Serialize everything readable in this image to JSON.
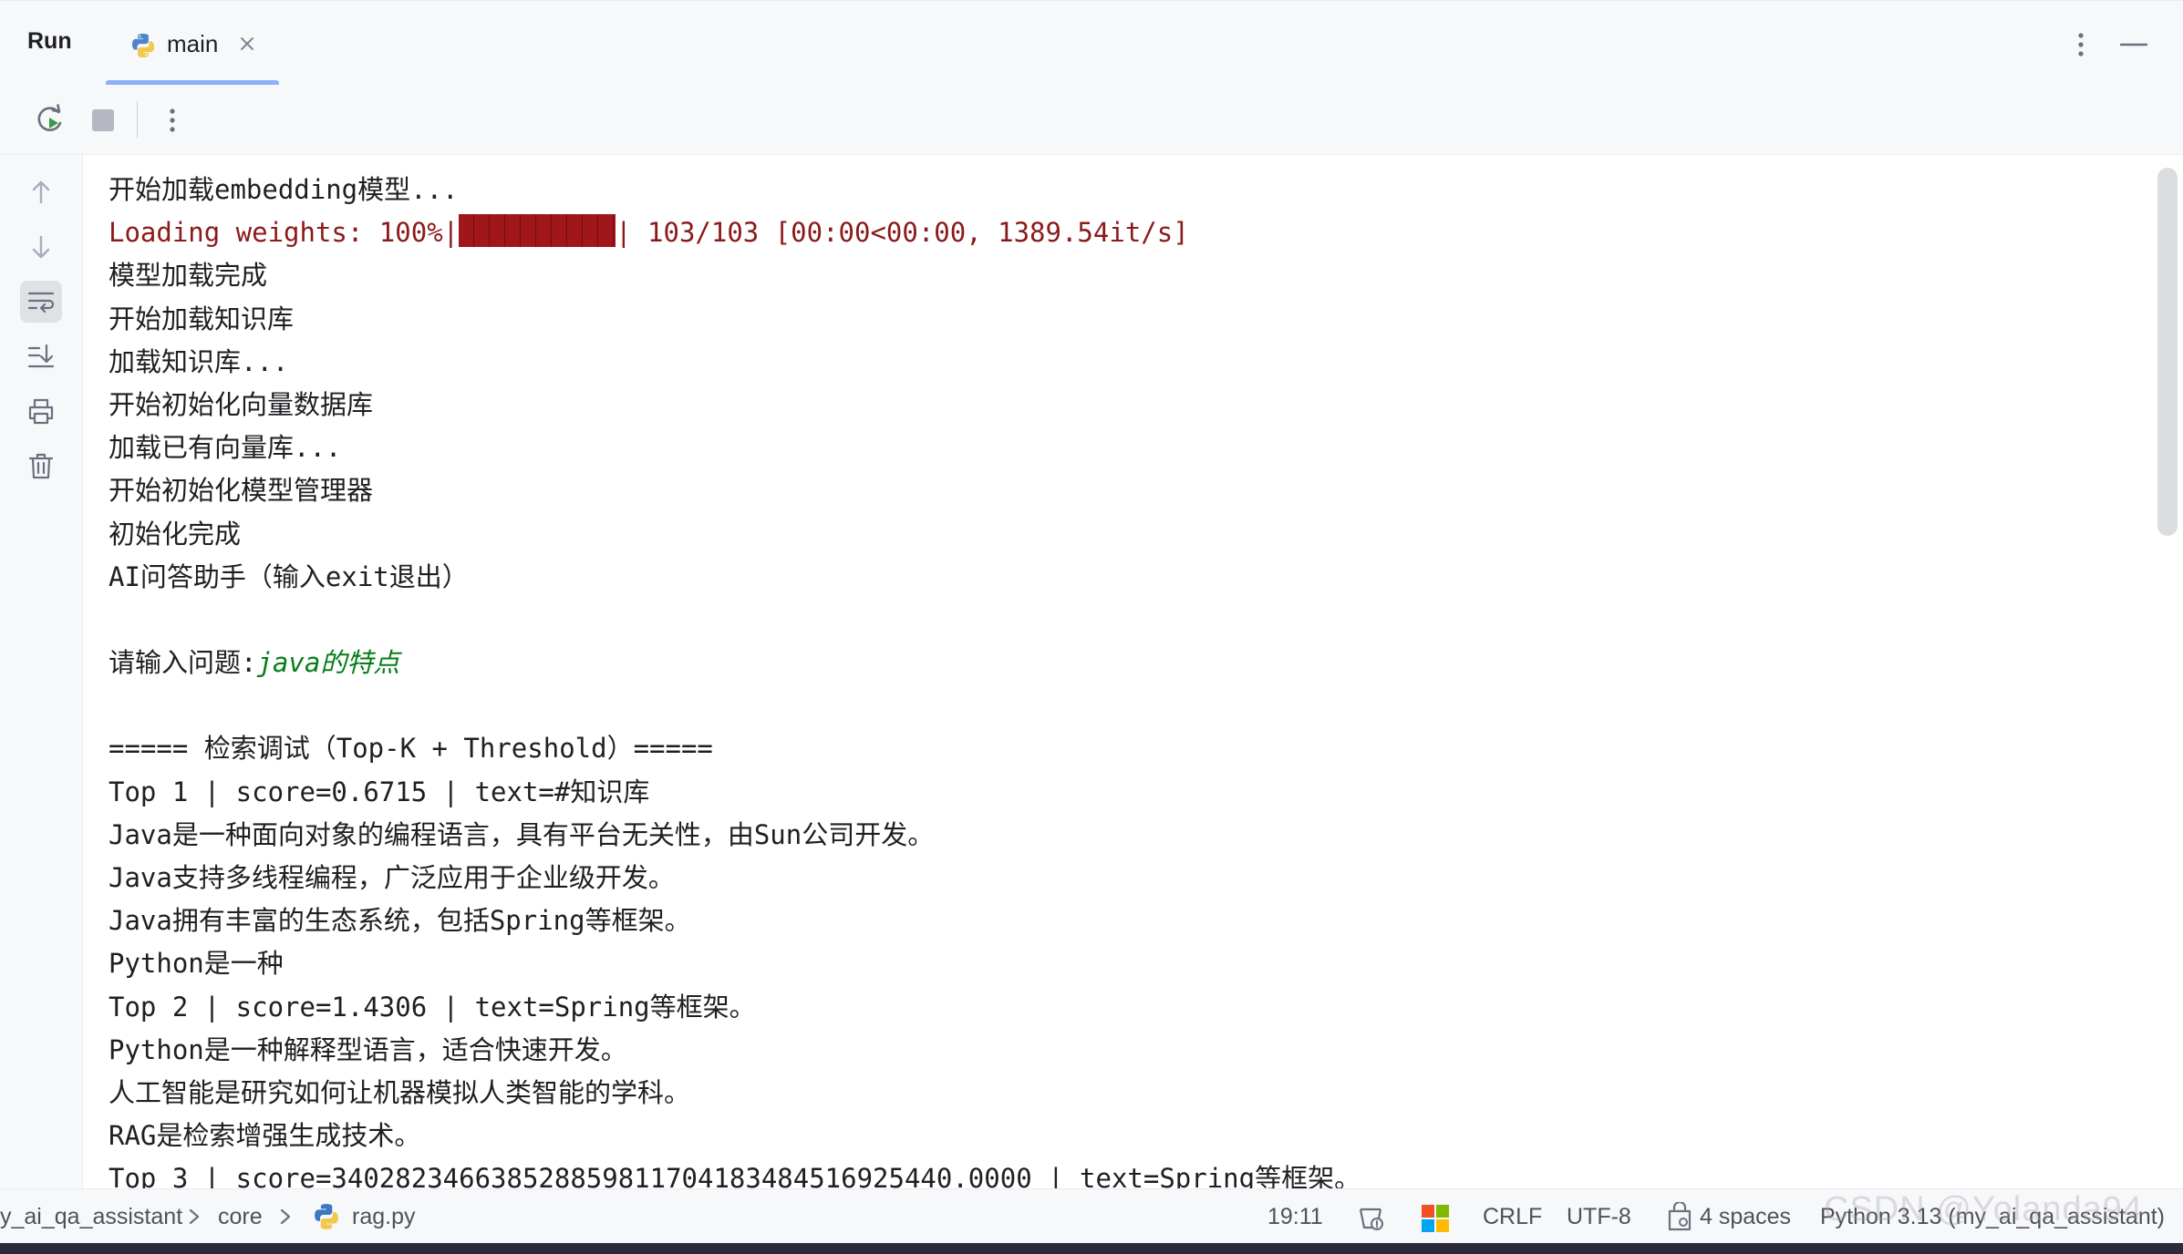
{
  "header": {
    "title": "Run",
    "tab": {
      "label": "main"
    }
  },
  "console": {
    "lines": [
      {
        "text": "开始加载embedding模型..."
      },
      {
        "prefix": "Loading weights: 100%|",
        "suffix": "| 103/103 [00:00<00:00, 1389.54it/s]",
        "progress_percent": 100
      },
      {
        "text": "模型加载完成"
      },
      {
        "text": "开始加载知识库"
      },
      {
        "text": "加载知识库..."
      },
      {
        "text": "开始初始化向量数据库"
      },
      {
        "text": "加载已有向量库..."
      },
      {
        "text": "开始初始化模型管理器"
      },
      {
        "text": "初始化完成"
      },
      {
        "text": "AI问答助手（输入exit退出）"
      },
      {
        "text": ""
      },
      {
        "prompt": "请输入问题:",
        "input": "java的特点"
      },
      {
        "text": ""
      },
      {
        "text": "===== 检索调试（Top-K + Threshold）====="
      },
      {
        "text": "Top 1 | score=0.6715 | text=#知识库"
      },
      {
        "text": "Java是一种面向对象的编程语言，具有平台无关性，由Sun公司开发。"
      },
      {
        "text": "Java支持多线程编程，广泛应用于企业级开发。"
      },
      {
        "text": "Java拥有丰富的生态系统，包括Spring等框架。"
      },
      {
        "text": "Python是一种"
      },
      {
        "text": "Top 2 | score=1.4306 | text=Spring等框架。"
      },
      {
        "text": "Python是一种解释型语言，适合快速开发。"
      },
      {
        "text": "人工智能是研究如何让机器模拟人类智能的学科。"
      },
      {
        "text": "RAG是检索增强生成技术。"
      },
      {
        "text": "Top 3 | score=340282346638528859811704183484516925440.0000 | text=Spring等框架。"
      }
    ]
  },
  "statusbar": {
    "breadcrumb": [
      "y_ai_qa_assistant",
      "core",
      "rag.py"
    ],
    "position": "19:11",
    "line_ending": "CRLF",
    "encoding": "UTF-8",
    "indent": "4 spaces",
    "interpreter": "Python 3.13 (my_ai_qa_assistant)"
  },
  "watermark": "CSDN @Yolanda94",
  "colors": {
    "accent": "#3574f0",
    "progress_bar": "#a0161a",
    "progress_text": "#8b1a1a",
    "user_input": "#067d17"
  }
}
